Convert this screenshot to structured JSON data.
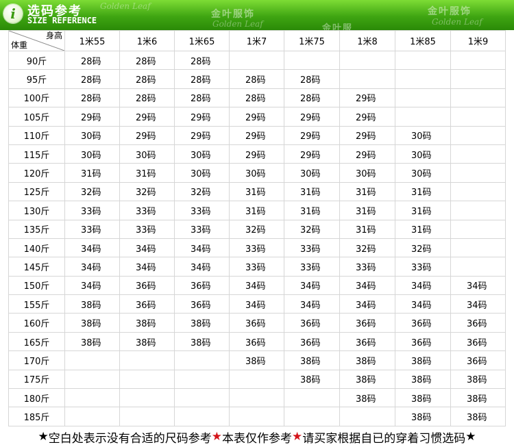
{
  "header": {
    "info_glyph": "i",
    "title_cn": "选码参考",
    "title_en": "SIZE REFERENCE",
    "brand_en": "Golden Leaf",
    "brand_cn": "金叶服饰",
    "brand_cn_partial": "金叶服",
    "color_primary": "#3fa512",
    "color_light": "#7ddc35"
  },
  "table": {
    "corner_height_label": "身高",
    "corner_weight_label": "体重",
    "heights": [
      "1米55",
      "1米6",
      "1米65",
      "1米7",
      "1米75",
      "1米8",
      "1米85",
      "1米9"
    ],
    "rows": [
      {
        "weight": "90斤",
        "sizes": [
          "28码",
          "28码",
          "28码",
          "",
          "",
          "",
          "",
          ""
        ]
      },
      {
        "weight": "95斤",
        "sizes": [
          "28码",
          "28码",
          "28码",
          "28码",
          "28码",
          "",
          "",
          ""
        ]
      },
      {
        "weight": "100斤",
        "sizes": [
          "28码",
          "28码",
          "28码",
          "28码",
          "28码",
          "29码",
          "",
          ""
        ]
      },
      {
        "weight": "105斤",
        "sizes": [
          "29码",
          "29码",
          "29码",
          "29码",
          "29码",
          "29码",
          "",
          ""
        ]
      },
      {
        "weight": "110斤",
        "sizes": [
          "30码",
          "29码",
          "29码",
          "29码",
          "29码",
          "29码",
          "30码",
          ""
        ]
      },
      {
        "weight": "115斤",
        "sizes": [
          "30码",
          "30码",
          "30码",
          "29码",
          "29码",
          "29码",
          "30码",
          ""
        ]
      },
      {
        "weight": "120斤",
        "sizes": [
          "31码",
          "31码",
          "30码",
          "30码",
          "30码",
          "30码",
          "30码",
          ""
        ]
      },
      {
        "weight": "125斤",
        "sizes": [
          "32码",
          "32码",
          "32码",
          "31码",
          "31码",
          "31码",
          "31码",
          ""
        ]
      },
      {
        "weight": "130斤",
        "sizes": [
          "33码",
          "33码",
          "33码",
          "31码",
          "31码",
          "31码",
          "31码",
          ""
        ]
      },
      {
        "weight": "135斤",
        "sizes": [
          "33码",
          "33码",
          "33码",
          "32码",
          "32码",
          "31码",
          "31码",
          ""
        ]
      },
      {
        "weight": "140斤",
        "sizes": [
          "34码",
          "34码",
          "34码",
          "33码",
          "33码",
          "32码",
          "32码",
          ""
        ]
      },
      {
        "weight": "145斤",
        "sizes": [
          "34码",
          "34码",
          "34码",
          "33码",
          "33码",
          "33码",
          "33码",
          ""
        ]
      },
      {
        "weight": "150斤",
        "sizes": [
          "34码",
          "36码",
          "36码",
          "34码",
          "34码",
          "34码",
          "34码",
          "34码"
        ]
      },
      {
        "weight": "155斤",
        "sizes": [
          "38码",
          "36码",
          "36码",
          "34码",
          "34码",
          "34码",
          "34码",
          "34码"
        ]
      },
      {
        "weight": "160斤",
        "sizes": [
          "38码",
          "38码",
          "38码",
          "36码",
          "36码",
          "36码",
          "36码",
          "36码"
        ]
      },
      {
        "weight": "165斤",
        "sizes": [
          "38码",
          "38码",
          "38码",
          "36码",
          "36码",
          "36码",
          "36码",
          "36码"
        ]
      },
      {
        "weight": "170斤",
        "sizes": [
          "",
          "",
          "",
          "38码",
          "38码",
          "38码",
          "38码",
          "36码"
        ]
      },
      {
        "weight": "175斤",
        "sizes": [
          "",
          "",
          "",
          "",
          "38码",
          "38码",
          "38码",
          "38码"
        ]
      },
      {
        "weight": "180斤",
        "sizes": [
          "",
          "",
          "",
          "",
          "",
          "38码",
          "38码",
          "38码"
        ]
      },
      {
        "weight": "185斤",
        "sizes": [
          "",
          "",
          "",
          "",
          "",
          "",
          "38码",
          "38码"
        ]
      }
    ]
  },
  "footer": {
    "star": "★",
    "note_1": "空白处表示没有合适的尺码参考",
    "note_2": "本表仅作参考",
    "note_3": "请买家根据自已的穿着习惯选码",
    "star_black_color": "#000000",
    "star_red_color": "#d4141a"
  }
}
